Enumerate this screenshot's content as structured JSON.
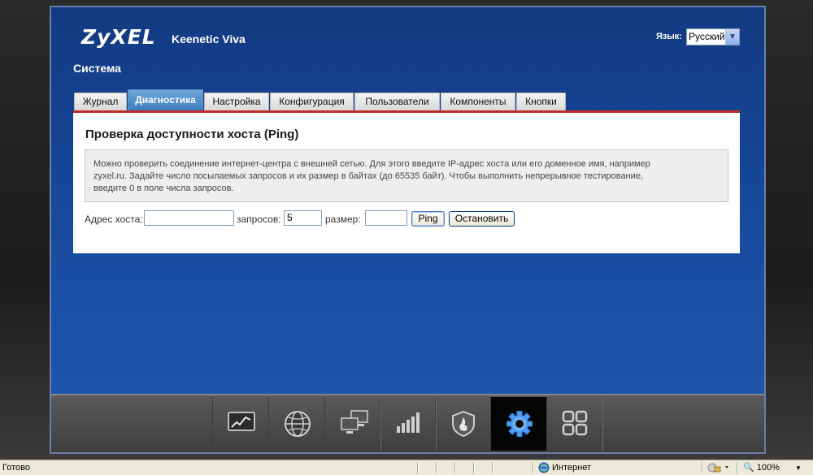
{
  "brand": {
    "logo": "ZyXEL",
    "model": "Keenetic Viva"
  },
  "language": {
    "label": "Язык:",
    "selected": "Русский"
  },
  "section_title": "Система",
  "tabs": [
    {
      "label": "Журнал",
      "active": false
    },
    {
      "label": "Диагностика",
      "active": true
    },
    {
      "label": "Настройка",
      "active": false
    },
    {
      "label": "Конфигурация",
      "active": false
    },
    {
      "label": "Пользователи",
      "active": false
    },
    {
      "label": "Компоненты",
      "active": false
    },
    {
      "label": "Кнопки",
      "active": false
    }
  ],
  "ping": {
    "title": "Проверка доступности хоста (Ping)",
    "info_line1": "Можно проверить соединение интернет-центра с внешней сетью. Для этого введите IP-адрес хоста или его доменное имя, например",
    "info_line2": "zyxel.ru. Задайте число посылаемых запросов и их размер в байтах (до 65535 байт). Чтобы выполнить непрерывное тестирование,",
    "info_line3": "введите 0 в поле числа запросов.",
    "host_label": "Адрес хоста:",
    "host_value": "",
    "requests_label": "запросов:",
    "requests_value": "5",
    "size_label": "размер:",
    "size_value": "",
    "ping_button": "Ping",
    "stop_button": "Остановить"
  },
  "bottom_nav": [
    {
      "icon": "chart-monitor-icon"
    },
    {
      "icon": "globe-icon"
    },
    {
      "icon": "network-computers-icon"
    },
    {
      "icon": "signal-bars-icon"
    },
    {
      "icon": "security-shield-icon"
    },
    {
      "icon": "gear-icon",
      "active": true
    },
    {
      "icon": "apps-grid-icon"
    }
  ],
  "statusbar": {
    "status": "Готово",
    "zone": "Интернет",
    "zoom": "100%"
  }
}
